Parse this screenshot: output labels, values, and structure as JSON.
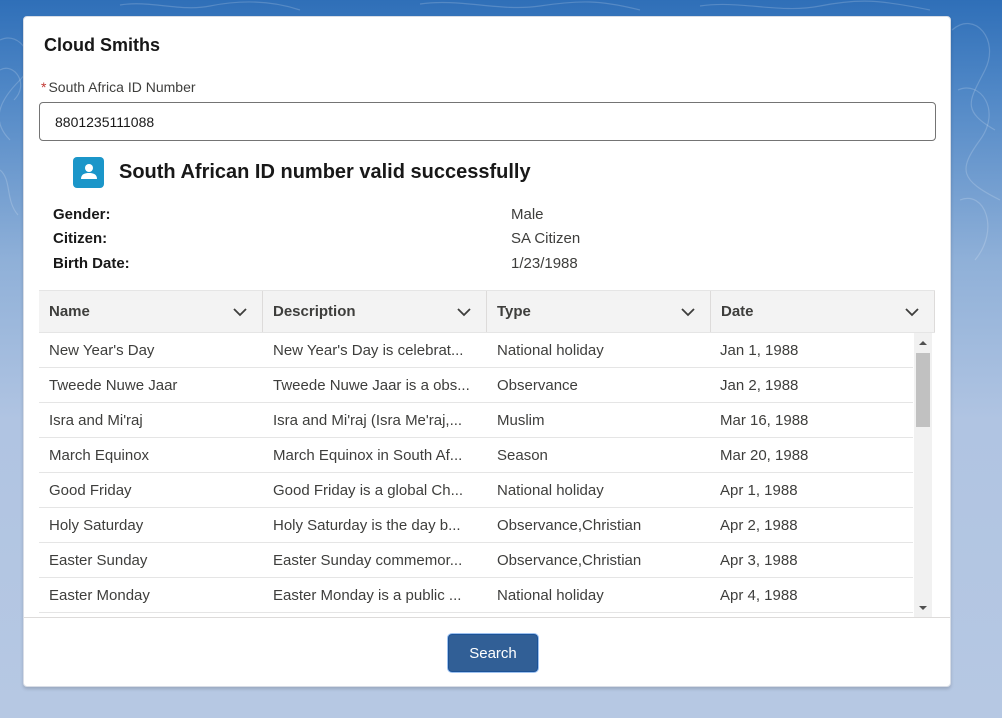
{
  "card": {
    "title": "Cloud Smiths"
  },
  "id_field": {
    "label": "South Africa ID Number",
    "value": "8801235111088"
  },
  "status": {
    "text": "South African ID number valid successfully"
  },
  "details": [
    {
      "label": "Gender:",
      "value": "Male"
    },
    {
      "label": "Citizen:",
      "value": "SA Citizen"
    },
    {
      "label": "Birth Date:",
      "value": "1/23/1988"
    }
  ],
  "table": {
    "columns": [
      "Name",
      "Description",
      "Type",
      "Date"
    ],
    "rows": [
      [
        "New Year's Day",
        "New Year's Day is celebrat...",
        "National holiday",
        "Jan 1, 1988"
      ],
      [
        "Tweede Nuwe Jaar",
        "Tweede Nuwe Jaar is a obs...",
        "Observance",
        "Jan 2, 1988"
      ],
      [
        "Isra and Mi'raj",
        "Isra and Mi'raj (Isra Me'raj,...",
        "Muslim",
        "Mar 16, 1988"
      ],
      [
        "March Equinox",
        "March Equinox in South Af...",
        "Season",
        "Mar 20, 1988"
      ],
      [
        "Good Friday",
        "Good Friday is a global Ch...",
        "National holiday",
        "Apr 1, 1988"
      ],
      [
        "Holy Saturday",
        "Holy Saturday is the day b...",
        "Observance,Christian",
        "Apr 2, 1988"
      ],
      [
        "Easter Sunday",
        "Easter Sunday commemor...",
        "Observance,Christian",
        "Apr 3, 1988"
      ],
      [
        "Easter Monday",
        "Easter Monday is a public ...",
        "National holiday",
        "Apr 4, 1988"
      ]
    ]
  },
  "footer": {
    "search_label": "Search"
  },
  "icons": {
    "status": "contact-icon",
    "column_menu": "chevron-down-icon",
    "scroll_up": "triangle-up-icon",
    "scroll_down": "triangle-down-icon"
  },
  "colors": {
    "brand_button": "#315f96",
    "status_icon": "#1b96c9",
    "required": "#c23934"
  }
}
